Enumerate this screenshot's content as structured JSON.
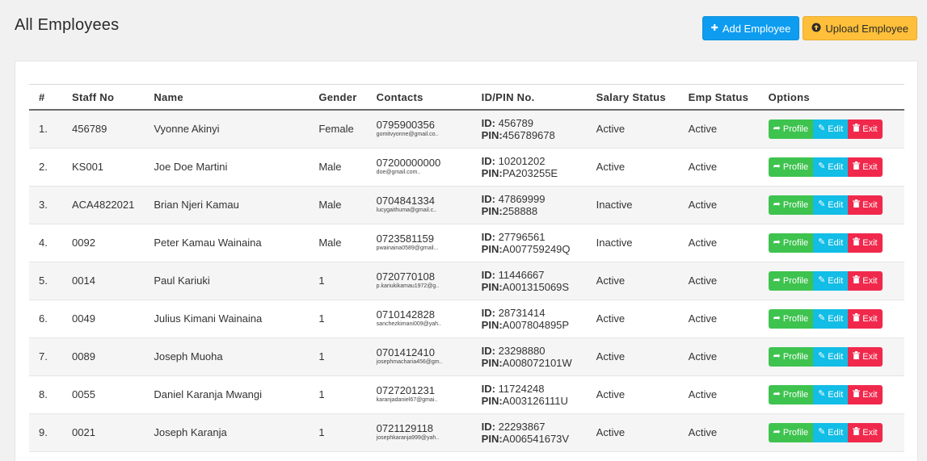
{
  "page_title": "All Employees",
  "actions": {
    "add_label": "Add Employee",
    "upload_label": "Upload Employee",
    "add_icon": "plus-icon",
    "upload_icon": "upload-circle-icon"
  },
  "colors": {
    "add": "#0d9cf0",
    "upload": "#ffbf3a",
    "profile": "#3ec34f",
    "edit": "#12bde6",
    "exit": "#f0294c"
  },
  "table": {
    "headers": [
      "#",
      "Staff No",
      "Name",
      "Gender",
      "Contacts",
      "ID/PIN No.",
      "Salary Status",
      "Emp Status",
      "Options"
    ],
    "option_labels": {
      "profile": "Profile",
      "edit": "Edit",
      "exit": "Exit"
    },
    "id_prefix": "ID:",
    "pin_prefix": "PIN:",
    "rows": [
      {
        "num": "1.",
        "staff_no": "456789",
        "name": "Vyonne Akinyi",
        "gender": "Female",
        "phone": "0795900356",
        "email": "gomitvyonne@gmail.co..",
        "id": "456789",
        "pin": "456789678",
        "salary_status": "Active",
        "emp_status": "Active"
      },
      {
        "num": "2.",
        "staff_no": "KS001",
        "name": "Joe Doe Martini",
        "gender": "Male",
        "phone": "07200000000",
        "email": "doe@gmail.com..",
        "id": "10201202",
        "pin": "PA203255E",
        "salary_status": "Active",
        "emp_status": "Active"
      },
      {
        "num": "3.",
        "staff_no": "ACA4822021",
        "name": "Brian Njeri Kamau",
        "gender": "Male",
        "phone": "0704841334",
        "email": "lucygaithuma@gmail.c..",
        "id": "47869999",
        "pin": "258888",
        "salary_status": "Inactive",
        "emp_status": "Active"
      },
      {
        "num": "4.",
        "staff_no": "0092",
        "name": "Peter Kamau Wainaina",
        "gender": "Male",
        "phone": "0723581159",
        "email": "pwainaina0589@gmail...",
        "id": "27796561",
        "pin": "A007759249Q",
        "salary_status": "Inactive",
        "emp_status": "Active"
      },
      {
        "num": "5.",
        "staff_no": "0014",
        "name": "Paul Kariuki",
        "gender": "1",
        "phone": "0720770108",
        "email": "p.kariukikamau1972@g..",
        "id": "11446667",
        "pin": "A001315069S",
        "salary_status": "Active",
        "emp_status": "Active"
      },
      {
        "num": "6.",
        "staff_no": "0049",
        "name": "Julius Kimani Wainaina",
        "gender": "1",
        "phone": "0710142828",
        "email": "sanchezkimani009@yah..",
        "id": "28731414",
        "pin": "A007804895P",
        "salary_status": "Active",
        "emp_status": "Active"
      },
      {
        "num": "7.",
        "staff_no": "0089",
        "name": "Joseph Muoha",
        "gender": "1",
        "phone": "0701412410",
        "email": "josephmacharia456@gm..",
        "id": "23298880",
        "pin": "A008072101W",
        "salary_status": "Active",
        "emp_status": "Active"
      },
      {
        "num": "8.",
        "staff_no": "0055",
        "name": "Daniel Karanja Mwangi",
        "gender": "1",
        "phone": "0727201231",
        "email": "karanjadaniel67@gmai..",
        "id": "11724248",
        "pin": "A003126111U",
        "salary_status": "Active",
        "emp_status": "Active"
      },
      {
        "num": "9.",
        "staff_no": "0021",
        "name": "Joseph Karanja",
        "gender": "1",
        "phone": "0721129118",
        "email": "josephkaranja999@yah..",
        "id": "22293867",
        "pin": "A006541673V",
        "salary_status": "Active",
        "emp_status": "Active"
      }
    ]
  }
}
